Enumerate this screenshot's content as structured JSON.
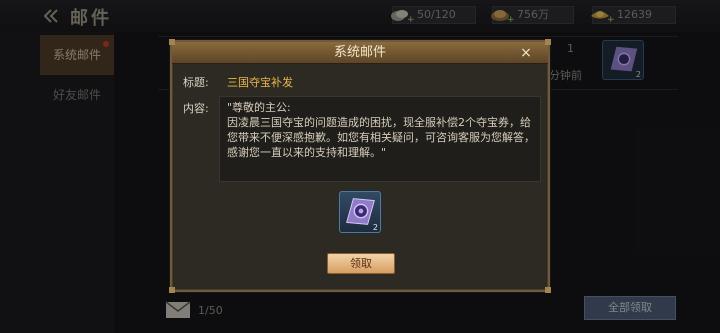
{
  "screen": {
    "title": "邮件",
    "resources": [
      {
        "name": "mail-capacity",
        "icon": "coin-pile-icon",
        "value": "50/120"
      },
      {
        "name": "copper",
        "icon": "copper-ingot-icon",
        "value": "756万"
      },
      {
        "name": "gold",
        "icon": "gold-ingot-icon",
        "value": "12639"
      }
    ]
  },
  "sidebar": {
    "items": [
      {
        "label": "系统邮件",
        "active": true,
        "has_notification": true
      },
      {
        "label": "好友邮件",
        "active": false
      }
    ]
  },
  "mail_list": {
    "row_count": "1",
    "row_time_fragment": "分钟前",
    "row_item_count": "2"
  },
  "footer": {
    "mail_count": "1/50",
    "claim_all_label": "全部领取"
  },
  "modal": {
    "title": "系统邮件",
    "close_glyph": "×",
    "subject_label": "标题:",
    "subject": "三国夺宝补发",
    "content_label": "内容:",
    "content": "\"尊敬的主公:\n因凌晨三国夺宝的问题造成的困扰，现全服补偿2个夺宝券，给您带来不便深感抱歉。如您有相关疑问，可咨询客服为您解答，感谢您一直以来的支持和理解。\"",
    "reward": {
      "icon": "treasure-scroll-icon",
      "count": "2"
    },
    "claim_label": "领取"
  },
  "colors": {
    "accent_gold": "#e8b84a",
    "modal_header": "#8a6a3e",
    "claim_button": "#e8b984",
    "claim_all_button": "#4a5a73"
  }
}
